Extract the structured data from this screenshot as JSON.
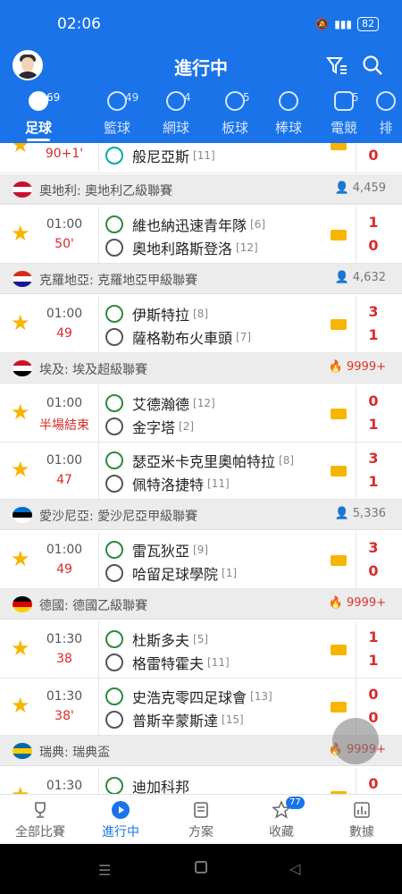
{
  "status": {
    "time": "02:06",
    "battery": "82"
  },
  "header": {
    "title": "進行中"
  },
  "tabs": [
    {
      "label": "足球",
      "count": "69",
      "icon": "soccer-ball-icon"
    },
    {
      "label": "籃球",
      "count": "49",
      "icon": "basketball-icon"
    },
    {
      "label": "網球",
      "count": "4",
      "icon": "tennis-icon"
    },
    {
      "label": "板球",
      "count": "5",
      "icon": "cricket-icon"
    },
    {
      "label": "棒球",
      "count": "",
      "icon": "baseball-icon"
    },
    {
      "label": "電競",
      "count": "5",
      "icon": "gamepad-icon"
    },
    {
      "label": "排",
      "count": "",
      "icon": "volleyball-icon"
    }
  ],
  "partial_match": {
    "minute": "90+1'",
    "away": "般尼亞斯",
    "away_rank": "[11]",
    "away_score": "0"
  },
  "leagues": [
    {
      "name": "奧地利: 奧地利乙級聯賽",
      "watch": "4,459",
      "hot": false,
      "flag": [
        "#c8102e",
        "#fff",
        "#c8102e"
      ],
      "matches": [
        {
          "time": "01:00",
          "minute": "50'",
          "home": "維也納迅速青年隊",
          "home_rank": "[6]",
          "away": "奧地利路斯登洛",
          "away_rank": "[12]",
          "home_score": "1",
          "away_score": "0"
        }
      ]
    },
    {
      "name": "克羅地亞: 克羅地亞甲級聯賽",
      "watch": "4,632",
      "hot": false,
      "flag": [
        "#d52b1e",
        "#fff",
        "#171796"
      ],
      "matches": [
        {
          "time": "01:00",
          "minute": "49",
          "home": "伊斯特拉",
          "home_rank": "[8]",
          "away": "薩格勒布火車頭",
          "away_rank": "[7]",
          "home_score": "3",
          "away_score": "1"
        }
      ]
    },
    {
      "name": "埃及: 埃及超級聯賽",
      "watch": "9999+",
      "hot": true,
      "flag": [
        "#ce1126",
        "#fff",
        "#000"
      ],
      "matches": [
        {
          "time": "01:00",
          "minute": "半場結束",
          "home": "艾德瀚德",
          "home_rank": "[12]",
          "away": "金字塔",
          "away_rank": "[2]",
          "home_score": "0",
          "away_score": "1"
        },
        {
          "time": "01:00",
          "minute": "47",
          "home": "瑟亞米卡克里奧帕特拉",
          "home_rank": "[8]",
          "away": "佩特洛捷特",
          "away_rank": "[11]",
          "home_score": "3",
          "away_score": "1"
        }
      ]
    },
    {
      "name": "愛沙尼亞: 愛沙尼亞甲級聯賽",
      "watch": "5,336",
      "hot": false,
      "flag": [
        "#0072ce",
        "#000",
        "#fff"
      ],
      "matches": [
        {
          "time": "01:00",
          "minute": "49",
          "home": "雷瓦狄亞",
          "home_rank": "[9]",
          "away": "哈留足球學院",
          "away_rank": "[1]",
          "home_score": "3",
          "away_score": "0"
        }
      ]
    },
    {
      "name": "德國: 德國乙級聯賽",
      "watch": "9999+",
      "hot": true,
      "flag": [
        "#000",
        "#dd0000",
        "#ffce00"
      ],
      "matches": [
        {
          "time": "01:30",
          "minute": "38",
          "home": "杜斯多夫",
          "home_rank": "[5]",
          "away": "格雷特霍夫",
          "away_rank": "[11]",
          "home_score": "1",
          "away_score": "1"
        },
        {
          "time": "01:30",
          "minute": "38'",
          "home": "史浩克零四足球會",
          "home_rank": "[13]",
          "away": "普斯辛蒙斯達",
          "away_rank": "[15]",
          "home_score": "0",
          "away_score": "0"
        }
      ]
    },
    {
      "name": "瑞典: 瑞典盃",
      "watch": "9999+",
      "hot": true,
      "flag": [
        "#006aa7",
        "#fecc00",
        "#006aa7"
      ],
      "matches": [
        {
          "time": "01:30",
          "minute": "",
          "home": "迪加科邦",
          "home_rank": "",
          "away": "",
          "away_rank": "",
          "home_score": "0",
          "away_score": ""
        }
      ]
    }
  ],
  "bottom_nav": [
    {
      "label": "全部比賽",
      "icon": "trophy-icon"
    },
    {
      "label": "進行中",
      "icon": "play-circle-icon"
    },
    {
      "label": "方案",
      "icon": "document-icon"
    },
    {
      "label": "收藏",
      "icon": "star-icon",
      "badge": "77"
    },
    {
      "label": "數據",
      "icon": "bar-chart-icon"
    }
  ],
  "colors": {
    "brand": "#1a73e8",
    "live": "#d82b2b",
    "star": "#f7b500"
  }
}
